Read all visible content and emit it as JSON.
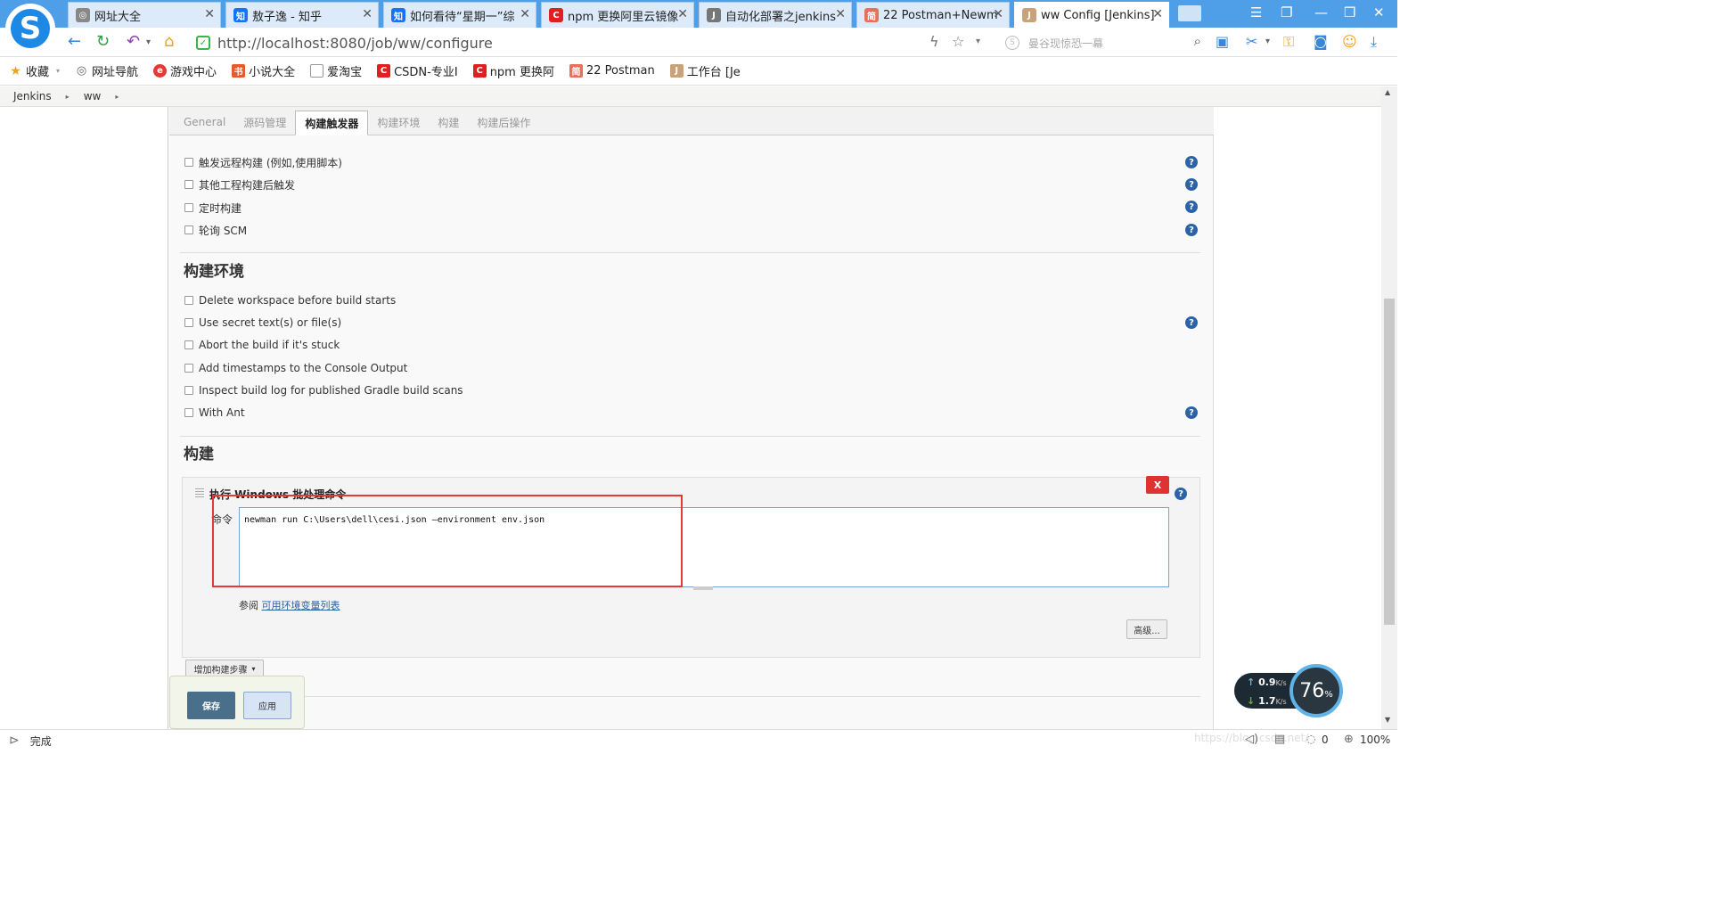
{
  "browser": {
    "logo": "S",
    "tabs": [
      {
        "title": "网址大全",
        "icon": "globe-icon",
        "color": "#888888"
      },
      {
        "title": "敖子逸 - 知乎",
        "icon": "zhihu-icon",
        "color": "#1772f6"
      },
      {
        "title": "如何看待“星期一”综",
        "icon": "zhihu-icon",
        "color": "#1772f6"
      },
      {
        "title": "npm 更换阿里云镜像",
        "icon": "csdn-icon",
        "color": "#e02020"
      },
      {
        "title": "自动化部署之jenkins",
        "icon": "jenkins-link-icon",
        "color": "#555555"
      },
      {
        "title": "22 Postman+Newm",
        "icon": "jianshu-icon",
        "color": "#ea6f5a"
      },
      {
        "title": "ww Config [Jenkins]",
        "icon": "jenkins-icon",
        "color": "#555555",
        "active": true
      }
    ],
    "url_host": "http://localhost:8080",
    "url_path": "/job/ww/configure",
    "search_placeholder": "曼谷现惊恐一幕",
    "bookmarks": [
      {
        "label": "收藏",
        "icon": "star-icon"
      },
      {
        "label": "网址导航",
        "icon": "globe-icon"
      },
      {
        "label": "游戏中心",
        "icon": "game-icon"
      },
      {
        "label": "小说大全",
        "icon": "book-icon"
      },
      {
        "label": "爱淘宝",
        "icon": "page-icon"
      },
      {
        "label": "CSDN-专业I",
        "icon": "csdn-icon"
      },
      {
        "label": "npm 更换阿",
        "icon": "csdn-icon"
      },
      {
        "label": "22 Postman",
        "icon": "jianshu-icon"
      },
      {
        "label": "工作台 [Je",
        "icon": "jenkins-icon"
      }
    ]
  },
  "breadcrumb": [
    "Jenkins",
    "ww"
  ],
  "config_tabs": [
    "General",
    "源码管理",
    "构建触发器",
    "构建环境",
    "构建",
    "构建后操作"
  ],
  "triggers": [
    {
      "label": "触发远程构建 (例如,使用脚本)"
    },
    {
      "label": "其他工程构建后触发"
    },
    {
      "label": "定时构建"
    },
    {
      "label": "轮询 SCM"
    }
  ],
  "env_section": {
    "title": "构建环境",
    "options": [
      {
        "label": "Delete workspace before build starts"
      },
      {
        "label": "Use secret text(s) or file(s)"
      },
      {
        "label": "Abort the build if it's stuck"
      },
      {
        "label": "Add timestamps to the Console Output"
      },
      {
        "label": "Inspect build log for published Gradle build scans"
      },
      {
        "label": "With Ant"
      }
    ]
  },
  "build_section": {
    "title": "构建",
    "step_title": "执行 Windows 批处理命令",
    "delete_label": "X",
    "command_label": "命令",
    "command_value": "newman run C:\\Users\\dell\\cesi.json —environment env.json",
    "ref_prefix": "参阅",
    "ref_link": "可用环境变量列表",
    "advanced_label": "高级...",
    "add_step_label": "增加构建步骤"
  },
  "actions": {
    "save": "保存",
    "apply": "应用"
  },
  "speed": {
    "up": "0.9",
    "down": "1.7",
    "unit": "K/s",
    "percent": "76",
    "percent_sign": "%"
  },
  "status": {
    "text": "完成",
    "count": "0",
    "zoom": "100%",
    "watermark": "https://blog.csdn.net/"
  },
  "colors": {
    "tabbar": "#4f9ee8",
    "help": "#2a63a8",
    "save": "#4a6f8a",
    "highlight": "#e53935"
  }
}
